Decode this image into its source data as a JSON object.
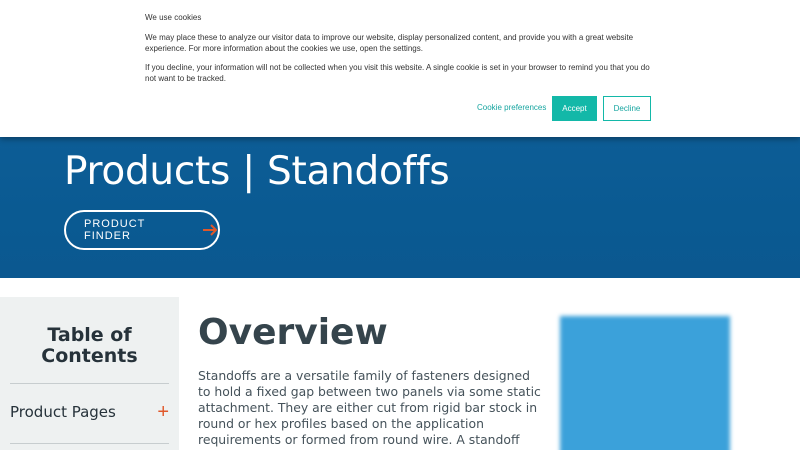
{
  "cookie_banner": {
    "title": "We use cookies",
    "paragraph1": "We may place these to analyze our visitor data to improve our website, display personalized content, and provide you with a great website experience. For more information about the cookies we use, open the settings.",
    "paragraph2": "If you decline, your information will not be collected when you visit this website. A single cookie is set in your browser to remind you that you do not want to be tracked.",
    "preferences_label": "Cookie preferences",
    "accept_label": "Accept",
    "decline_label": "Decline"
  },
  "hero": {
    "title": "Products | Standoffs",
    "finder_label": "PRODUCT FINDER",
    "finder_icon": "arrow-right-icon",
    "background_color": "#0b5a92",
    "accent_color": "#e0582a"
  },
  "toc": {
    "title": "Table of Contents",
    "items": [
      {
        "label": "Product Pages",
        "icon": "plus-icon"
      }
    ]
  },
  "main": {
    "heading": "Overview",
    "body": "Standoffs are a versatile family of fasteners designed to hold a fixed gap between two panels via some static attachment. They are either cut from rigid bar stock in round or hex profiles based on the application requirements or formed from round wire. A standoff with a male attachment has external threads"
  }
}
